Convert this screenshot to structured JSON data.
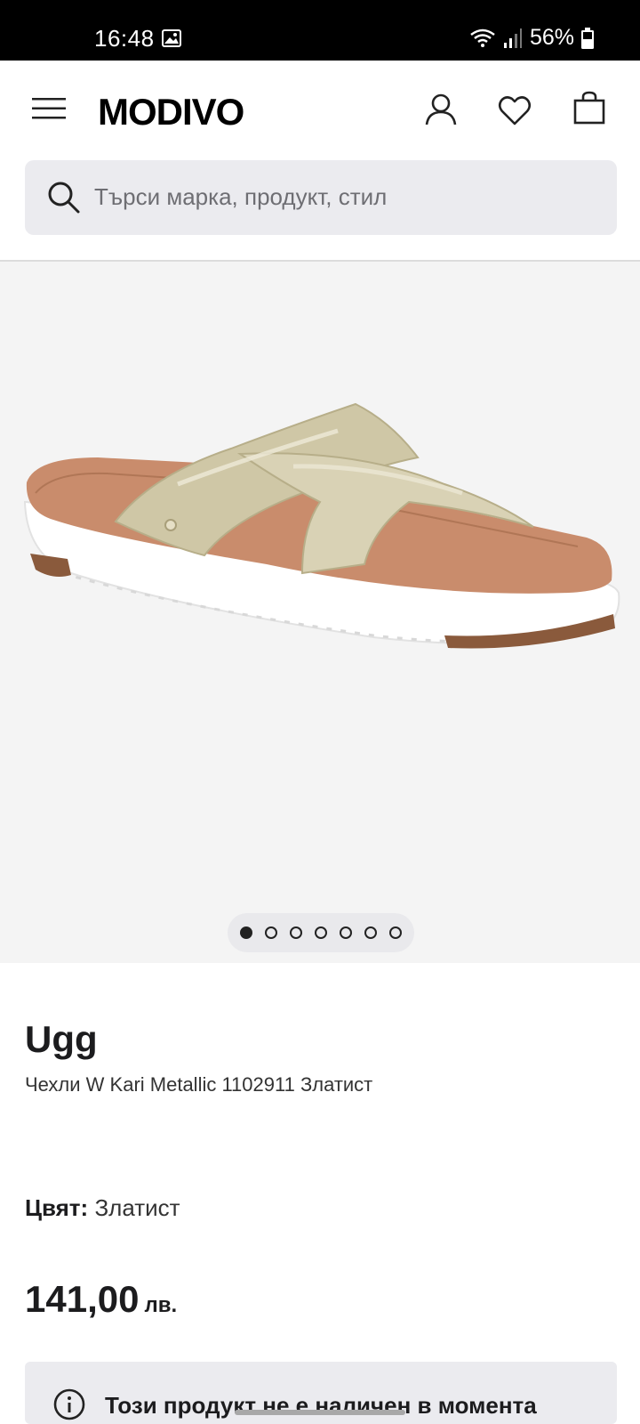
{
  "status_bar": {
    "time": "16:48",
    "battery": "56%"
  },
  "header": {
    "logo": "MODIVO"
  },
  "search": {
    "placeholder": "Търси марка, продукт, стил"
  },
  "gallery": {
    "image_count": 7,
    "active_index": 0
  },
  "product": {
    "brand": "Ugg",
    "name": "Чехли W Kari Metallic 1102911 Златист",
    "color_label": "Цвят:",
    "color_value": "Златист",
    "price_value": "141,00",
    "price_currency": "лв."
  },
  "notice": {
    "text": "Този продукт не е наличен в момента"
  },
  "colors": {
    "accent": "#1c1c1e",
    "search_bg": "#ebebef",
    "gallery_bg": "#f4f4f4"
  }
}
